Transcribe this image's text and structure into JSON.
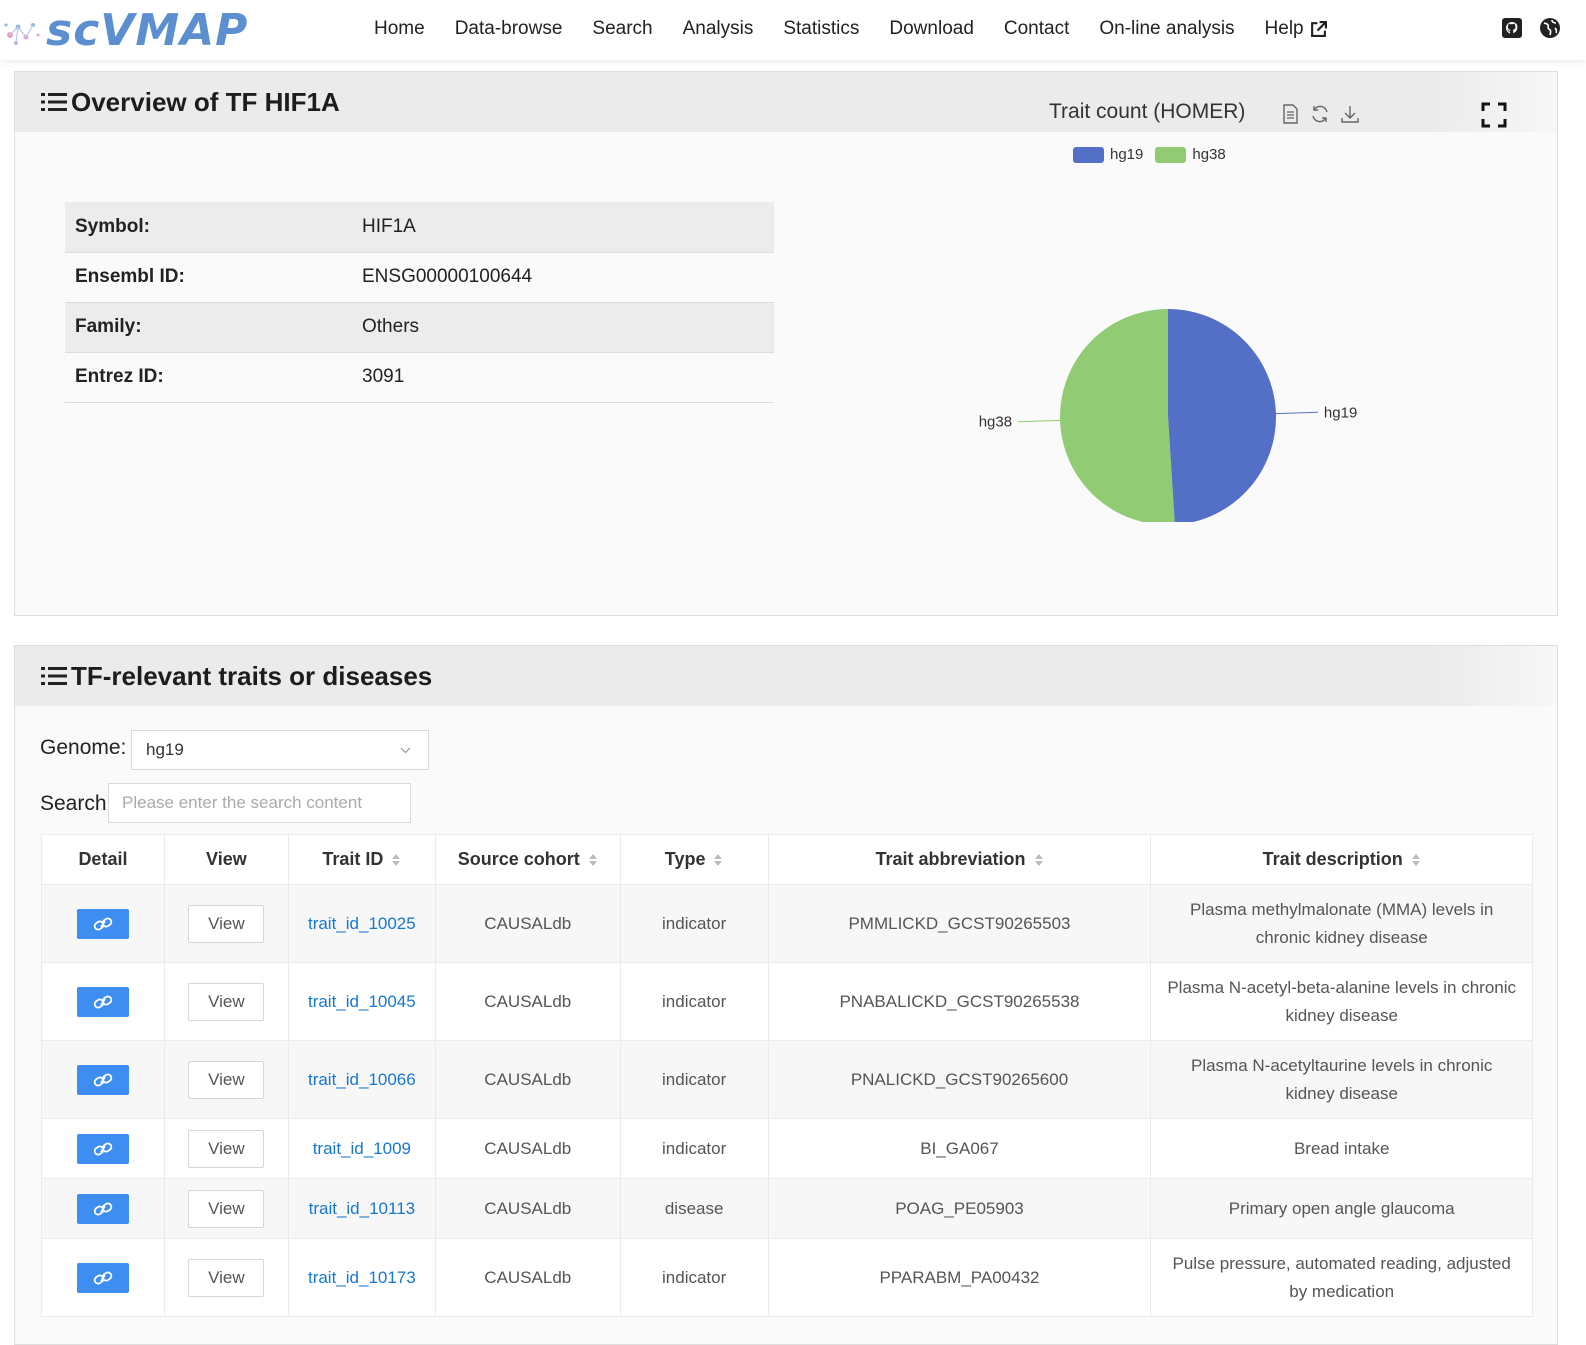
{
  "header": {
    "logo_text": "scVMAP",
    "nav": [
      "Home",
      "Data-browse",
      "Search",
      "Analysis",
      "Statistics",
      "Download",
      "Contact",
      "On-line analysis",
      "Help"
    ]
  },
  "overview": {
    "title": "Overview of TF HIF1A",
    "fields": [
      {
        "label": "Symbol:",
        "value": "HIF1A"
      },
      {
        "label": "Ensembl ID:",
        "value": "ENSG00000100644"
      },
      {
        "label": "Family:",
        "value": "Others"
      },
      {
        "label": "Entrez ID:",
        "value": "3091"
      }
    ]
  },
  "chart_data": {
    "type": "pie",
    "title": "Trait count (HOMER)",
    "categories": [
      "hg19",
      "hg38"
    ],
    "values": [
      49,
      51
    ],
    "colors": [
      "#5470c6",
      "#91cc75"
    ],
    "legend": "top-center"
  },
  "traits": {
    "title": "TF-relevant traits or diseases",
    "genome_label": "Genome:",
    "genome_value": "hg19",
    "search_label": "Search:",
    "search_placeholder": "Please enter the search content",
    "columns": [
      "Detail",
      "View",
      "Trait ID",
      "Source cohort",
      "Type",
      "Trait abbreviation",
      "Trait description"
    ],
    "view_label": "View",
    "rows": [
      {
        "id": "trait_id_10025",
        "cohort": "CAUSALdb",
        "type": "indicator",
        "abbr": "PMMLICKD_GCST90265503",
        "desc": "Plasma methylmalonate (MMA) levels in chronic kidney disease"
      },
      {
        "id": "trait_id_10045",
        "cohort": "CAUSALdb",
        "type": "indicator",
        "abbr": "PNABALICKD_GCST90265538",
        "desc": "Plasma N-acetyl-beta-alanine levels in chronic kidney disease"
      },
      {
        "id": "trait_id_10066",
        "cohort": "CAUSALdb",
        "type": "indicator",
        "abbr": "PNALICKD_GCST90265600",
        "desc": "Plasma N-acetyltaurine levels in chronic kidney disease"
      },
      {
        "id": "trait_id_1009",
        "cohort": "CAUSALdb",
        "type": "indicator",
        "abbr": "BI_GA067",
        "desc": "Bread intake"
      },
      {
        "id": "trait_id_10113",
        "cohort": "CAUSALdb",
        "type": "disease",
        "abbr": "POAG_PE05903",
        "desc": "Primary open angle glaucoma"
      },
      {
        "id": "trait_id_10173",
        "cohort": "CAUSALdb",
        "type": "indicator",
        "abbr": "PPARABM_PA00432",
        "desc": "Pulse pressure, automated reading, adjusted by medication"
      }
    ]
  }
}
